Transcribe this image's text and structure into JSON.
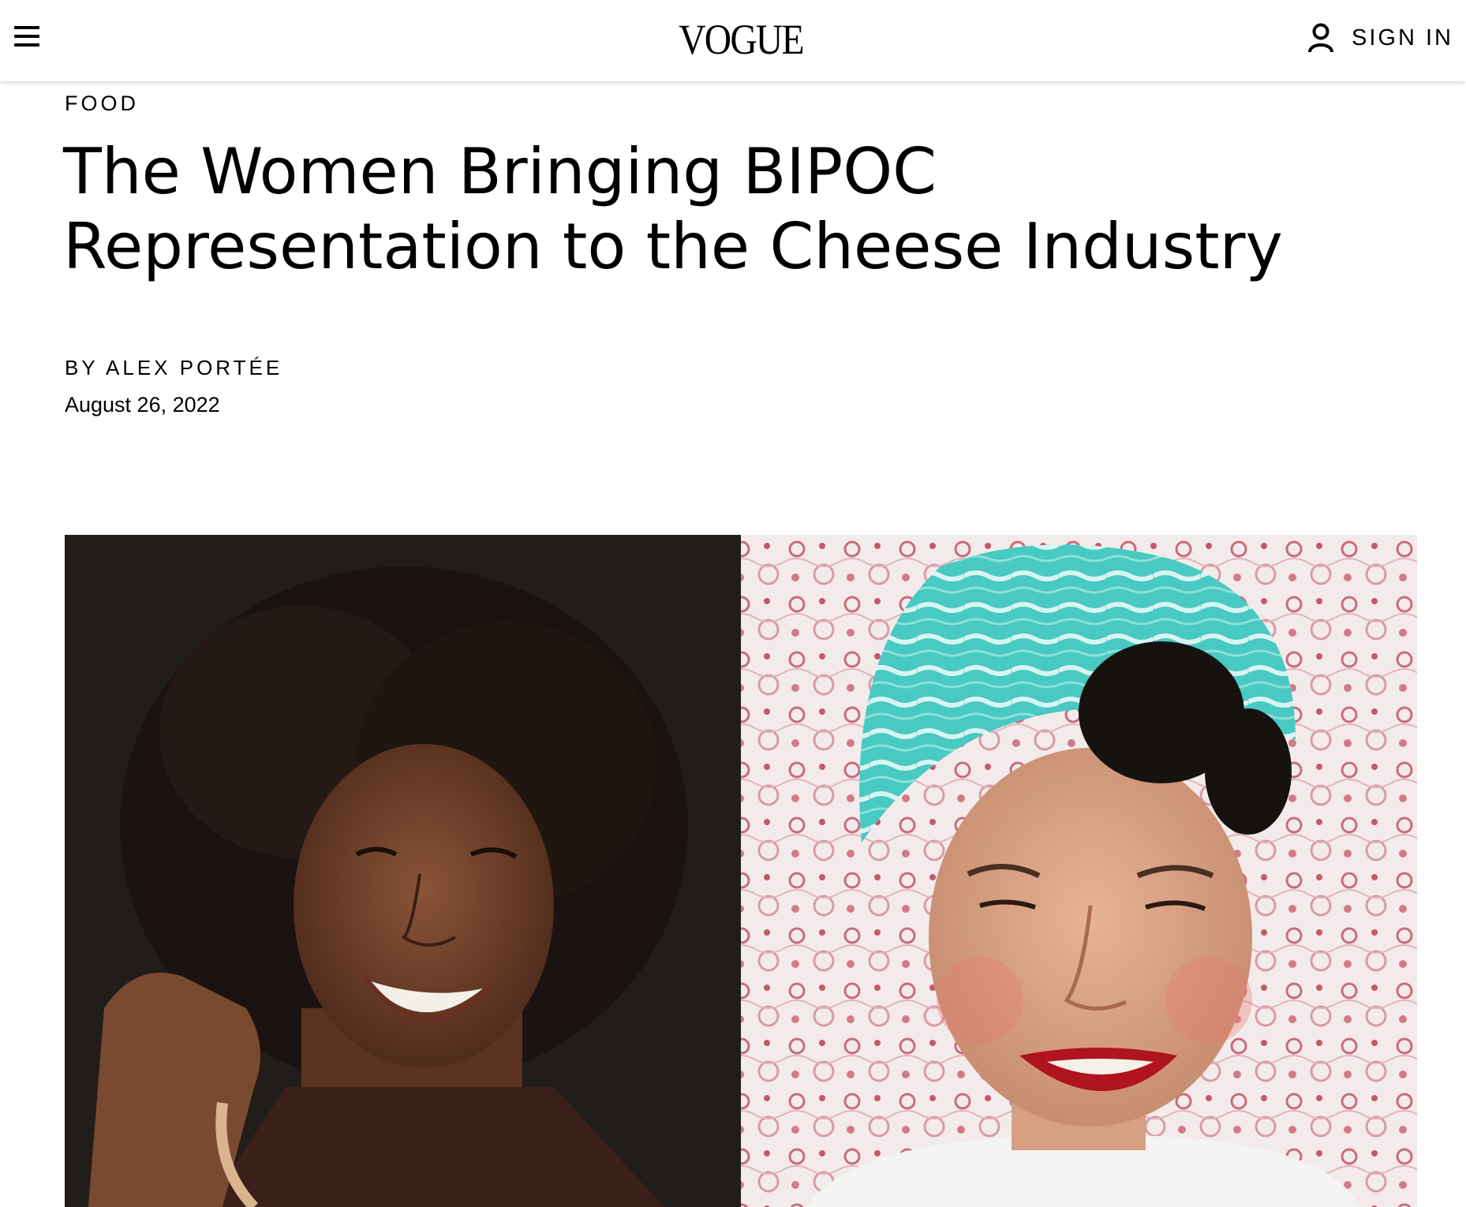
{
  "header": {
    "logo": "VOGUE",
    "sign_in_label": "SIGN IN"
  },
  "article": {
    "rubric": "FOOD",
    "headline": "The Women Bringing BIPOC Representation to the Cheese Industry",
    "byline_prefix": "BY",
    "author": "ALEX PORTÉE",
    "date": "August 26, 2022"
  },
  "icons": {
    "menu": "hamburger-menu-icon",
    "account": "user-account-icon"
  }
}
